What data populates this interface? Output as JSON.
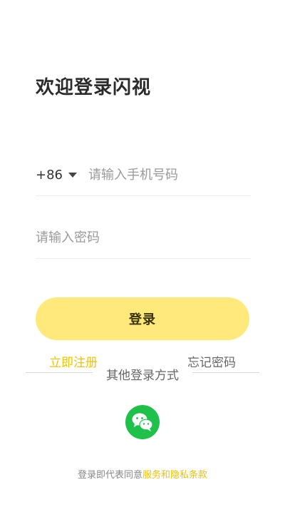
{
  "header": {
    "title": "欢迎登录闪视"
  },
  "phone": {
    "country_code": "+86",
    "placeholder": "请输入手机号码",
    "value": ""
  },
  "password": {
    "placeholder": "请输入密码",
    "value": ""
  },
  "actions": {
    "login_label": "登录",
    "register_label": "立即注册",
    "forgot_label": "忘记密码"
  },
  "other_methods": {
    "label": "其他登录方式",
    "items": [
      {
        "icon": "wechat-icon"
      }
    ]
  },
  "agreement": {
    "prefix": "登录即代表同意",
    "link_label": "服务和隐私条款"
  },
  "colors": {
    "accent_yellow": "#ffe97b",
    "link_yellow": "#f2c300",
    "wechat_green": "#1fc14a"
  }
}
